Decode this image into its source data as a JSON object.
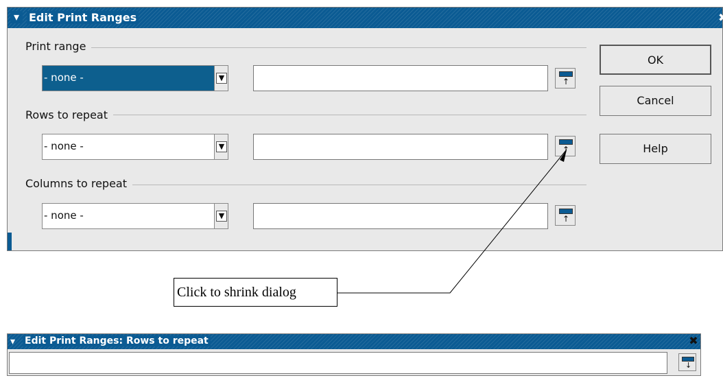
{
  "dialog": {
    "title": "Edit Print Ranges",
    "menu_icon": "chevron-down-icon",
    "close_icon": "close-icon",
    "groups": [
      {
        "label": "Print range",
        "select_value": "- none -",
        "select_selected": true,
        "field_value": ""
      },
      {
        "label": "Rows to repeat",
        "select_value": "- none -",
        "select_selected": false,
        "field_value": ""
      },
      {
        "label": "Columns to repeat",
        "select_value": "- none -",
        "select_selected": false,
        "field_value": ""
      }
    ],
    "buttons": {
      "ok": "OK",
      "cancel": "Cancel",
      "help": "Help"
    }
  },
  "annotation": {
    "callout": "Click to shrink dialog"
  },
  "shrunk_dialog": {
    "title": "Edit Print Ranges: Rows to repeat",
    "field_value": ""
  },
  "colors": {
    "titlebar": "#0b5b93",
    "dialog_bg": "#e9e9e9",
    "selected": "#0d5f8e"
  }
}
